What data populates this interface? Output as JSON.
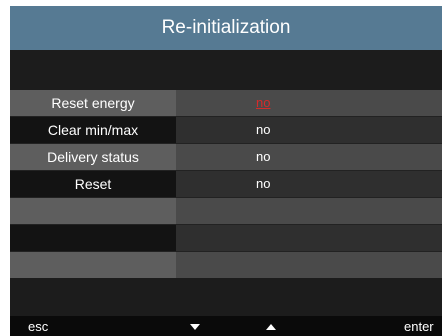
{
  "title": "Re-initialization",
  "menu": {
    "items": [
      {
        "label": "Reset energy",
        "value": "no"
      },
      {
        "label": "Clear min/max",
        "value": "no"
      },
      {
        "label": "Delivery status",
        "value": "no"
      },
      {
        "label": "Reset",
        "value": "no"
      }
    ]
  },
  "footer": {
    "esc_label": "esc",
    "enter_label": "enter",
    "down_icon": "triangle-down-icon",
    "up_icon": "triangle-up-icon"
  },
  "colors": {
    "title_bar": "#567a93",
    "selected_value": "#d42b2b"
  }
}
